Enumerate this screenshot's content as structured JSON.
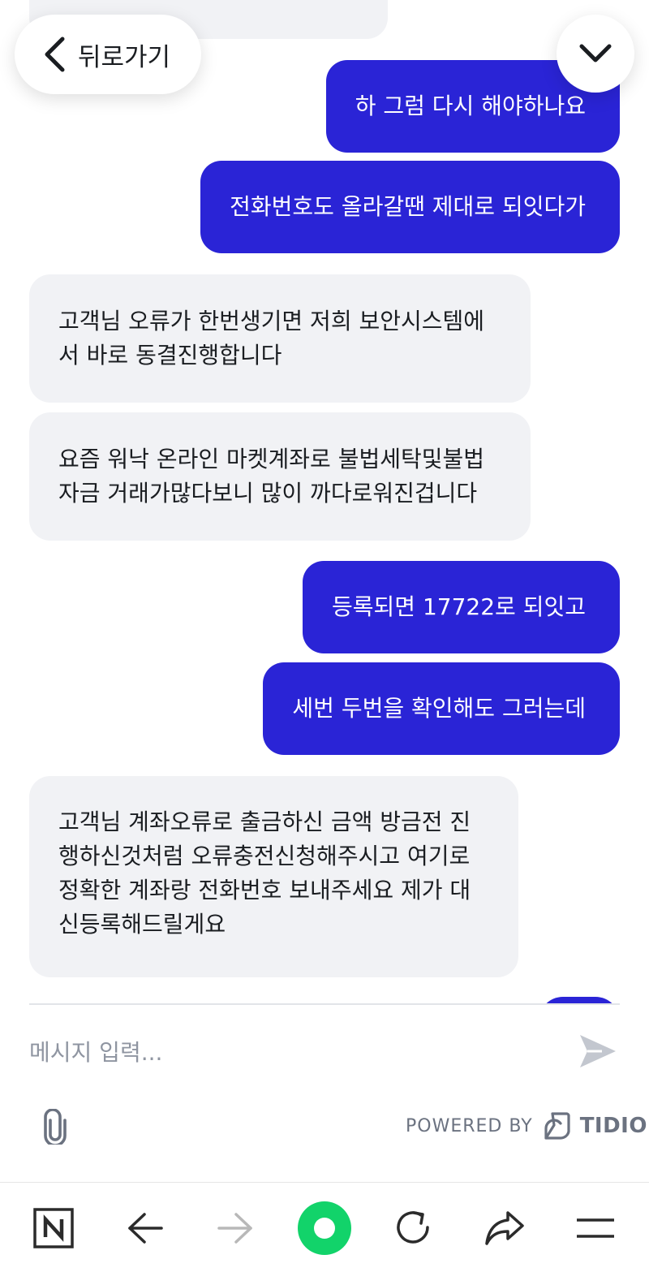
{
  "header": {
    "back_label": "뒤로가기"
  },
  "messages": [
    {
      "from": "operator",
      "text": ""
    },
    {
      "from": "visitor",
      "text": "하 그럼 다시 해야하나요"
    },
    {
      "from": "visitor",
      "text": "전화번호도 올라갈땐 제대로 되잇다가"
    },
    {
      "from": "operator",
      "lines": [
        "고객님 오류가 한번생기면 저희 보안시스템에",
        "서 바로 동결진행합니다"
      ]
    },
    {
      "from": "operator",
      "lines": [
        "요즘 워낙 온라인 마켓계좌로 불법세탁및불법",
        "자금 거래가많다보니 많이 까다로워진겁니다"
      ]
    },
    {
      "from": "visitor",
      "text": "등록되면 17722로 되잇고"
    },
    {
      "from": "visitor",
      "text": "세번 두번을 확인해도 그러는데"
    },
    {
      "from": "operator",
      "lines": [
        "고객님 계좌오류로 출금하신 금액 방금전 진",
        "행하신것처럼 오류충전신청해주시고 여기로",
        "정확한 계좌랑 전화번호 보내주세요 제가 대",
        "신등록해드릴게요"
      ]
    }
  ],
  "composer": {
    "placeholder": "메시지 입력..."
  },
  "footer": {
    "powered_by": "POWERED BY",
    "brand": "TIDIO"
  },
  "colors": {
    "visitor_bubble": "#2a24d6",
    "operator_bubble": "#f1f2f5",
    "home_button": "#12d36a"
  },
  "icons": {
    "back": "chevron-left-icon",
    "collapse": "chevron-down-icon",
    "send": "send-icon",
    "attach": "paperclip-icon",
    "brand": "tidio-logo-icon",
    "browser_nav": [
      "naver-n-icon",
      "arrow-left-icon",
      "arrow-right-icon",
      "home-orb-icon",
      "refresh-icon",
      "share-icon",
      "menu-icon"
    ]
  }
}
